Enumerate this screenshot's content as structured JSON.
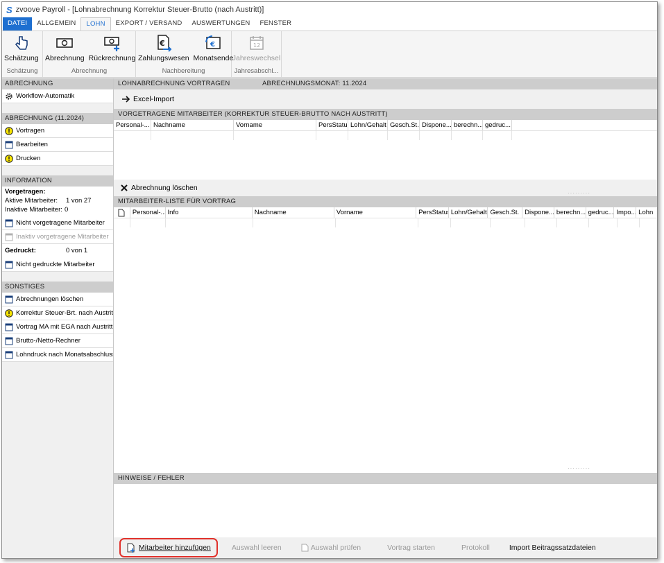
{
  "window": {
    "title": "zvoove Payroll - [Lohnabrechnung Korrektur Steuer-Brutto (nach Austritt)]"
  },
  "menu": {
    "tabs": [
      "DATEI",
      "ALLGEMEIN",
      "LOHN",
      "EXPORT / VERSAND",
      "AUSWERTUNGEN",
      "FENSTER"
    ]
  },
  "ribbon": {
    "groups": [
      {
        "label": "Schätzung",
        "buttons": [
          "Schätzung"
        ]
      },
      {
        "label": "Abrechnung",
        "buttons": [
          "Abrechnung",
          "Rückrechnung"
        ]
      },
      {
        "label": "Nachbereitung",
        "buttons": [
          "Zahlungswesen",
          "Monatsende"
        ]
      },
      {
        "label": "Jahresabschl...",
        "buttons": [
          "Jahreswechsel"
        ]
      }
    ]
  },
  "sidebar": {
    "abrechnung_header": "ABRECHNUNG",
    "workflow": "Workflow-Automatik",
    "period_header": "ABRECHNUNG (11.2024)",
    "period_items": [
      "Vortragen",
      "Bearbeiten",
      "Drucken"
    ],
    "information_header": "INFORMATION",
    "vorgetragen_label": "Vorgetragen:",
    "aktive_label": "Aktive Mitarbeiter:",
    "aktive_value": "1 von 27",
    "inaktive_label": "Inaktive Mitarbeiter:",
    "inaktive_value": "0",
    "nicht_vorgetragene": "Nicht vorgetragene Mitarbeiter",
    "inaktiv_vorgetragene": "Inaktiv vorgetragene Mitarbeiter",
    "gedruckt_label": "Gedruckt:",
    "gedruckt_value": "0 von 1",
    "nicht_gedruckte": "Nicht gedruckte Mitarbeiter",
    "sonstiges_header": "SONSTIGES",
    "sonstiges_items": [
      "Abrechnungen löschen",
      "Korrektur Steuer-Brt. nach Austritt",
      "Vortrag MA mit EGA nach Austritt",
      "Brutto-/Netto-Rechner",
      "Lohndruck nach Monatsabschluss"
    ]
  },
  "content": {
    "header_left": "LOHNABRECHNUNG VORTRAGEN",
    "header_right": "ABRECHNUNGSMONAT:  11.2024",
    "excel_import": "Excel-Import",
    "vorgetragene_header": "VORGETRAGENE MITARBEITER (KORREKTUR STEUER-BRUTTO NACH AUSTRITT)",
    "vorgetragene_columns": [
      "Personal-...",
      "Nachname",
      "Vorname",
      "PersStatus",
      "Lohn/Gehalt",
      "Gesch.St.",
      "Dispone...",
      "berechn...",
      "gedruc..."
    ],
    "abrechnung_loeschen": "Abrechnung löschen",
    "liste_header": "MITARBEITER-LISTE FÜR VORTRAG",
    "liste_columns": [
      "",
      "Personal-...",
      "Info",
      "Nachname",
      "Vorname",
      "PersStatus",
      "Lohn/Gehalt",
      "Gesch.St.",
      "Dispone...",
      "berechn...",
      "gedruc...",
      "Impo...",
      "Lohn"
    ],
    "hinweise_header": "HINWEISE / FEHLER"
  },
  "bottom": {
    "mitarbeiter_hinzufuegen": "Mitarbeiter hinzufügen",
    "auswahl_leeren": "Auswahl leeren",
    "auswahl_pruefen": "Auswahl prüfen",
    "vortrag_starten": "Vortrag starten",
    "protokoll": "Protokoll",
    "import": "Import Beitragssatzdateien"
  }
}
